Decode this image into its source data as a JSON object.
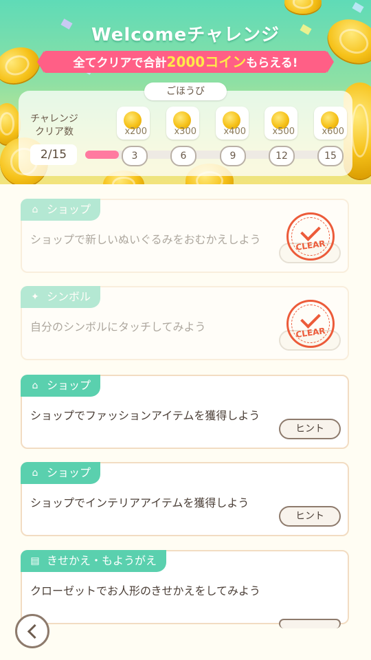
{
  "header": {
    "title": "Welcomeチャレンジ",
    "banner_prefix": "全てクリアで合計",
    "banner_amount": "2000コイン",
    "banner_suffix": "もらえる!"
  },
  "rewards": {
    "label": "ごほうび",
    "progress_label": "チャレンジ\nクリア数",
    "count": "2/15",
    "progress_fraction": 0.133,
    "items": [
      {
        "qty": "x200",
        "step": "3"
      },
      {
        "qty": "x300",
        "step": "6"
      },
      {
        "qty": "x400",
        "step": "9"
      },
      {
        "qty": "x500",
        "step": "12"
      },
      {
        "qty": "x600",
        "step": "15"
      }
    ]
  },
  "challenges": [
    {
      "category": "ショップ",
      "icon": "shop-icon",
      "text": "ショップで新しいぬいぐるみをおむかえしよう",
      "cleared": true,
      "stamp": "CLEAR"
    },
    {
      "category": "シンボル",
      "icon": "sparkle-icon",
      "text": "自分のシンボルにタッチしてみよう",
      "cleared": true,
      "stamp": "CLEAR"
    },
    {
      "category": "ショップ",
      "icon": "shop-icon",
      "text": "ショップでファッションアイテムを獲得しよう",
      "cleared": false,
      "button": "ヒント"
    },
    {
      "category": "ショップ",
      "icon": "shop-icon",
      "text": "ショップでインテリアアイテムを獲得しよう",
      "cleared": false,
      "button": "ヒント"
    },
    {
      "category": "きせかえ・もようがえ",
      "icon": "closet-icon",
      "text": "クローゼットでお人形のきせかえをしてみよう",
      "cleared": false
    }
  ],
  "colors": {
    "accent": "#5ad0ae",
    "ribbon": "#ff5f86",
    "stamp": "#ec5b3a"
  }
}
